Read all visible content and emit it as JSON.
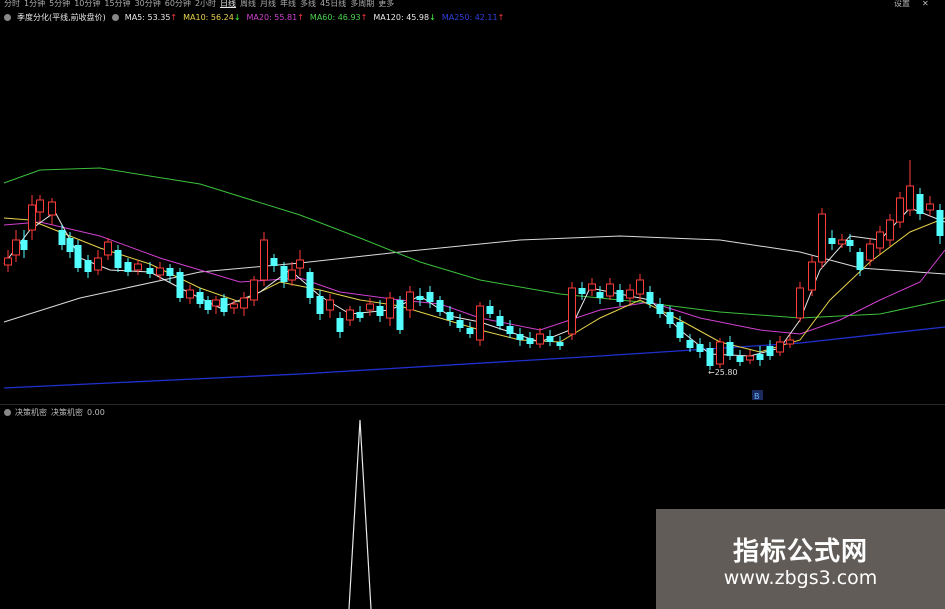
{
  "toolbar": {
    "periods": [
      {
        "label": "分时",
        "state": "normal"
      },
      {
        "label": "1分钟",
        "state": "normal"
      },
      {
        "label": "5分钟",
        "state": "normal"
      },
      {
        "label": "10分钟",
        "state": "normal"
      },
      {
        "label": "15分钟",
        "state": "normal"
      },
      {
        "label": "30分钟",
        "state": "normal"
      },
      {
        "label": "60分钟",
        "state": "normal"
      },
      {
        "label": "2小时",
        "state": "normal"
      },
      {
        "label": "日线",
        "state": "selected"
      },
      {
        "label": "周线",
        "state": "normal"
      },
      {
        "label": "月线",
        "state": "normal"
      },
      {
        "label": "年线",
        "state": "normal"
      },
      {
        "label": "多线",
        "state": "normal"
      },
      {
        "label": "45日线",
        "state": "normal"
      },
      {
        "label": "多周期",
        "state": "normal"
      },
      {
        "label": "更多",
        "state": "normal"
      }
    ],
    "settings_label": "设置",
    "close_label": "✕"
  },
  "ma_legend": {
    "title": "季度分化(平线,前收盘价)",
    "items": [
      {
        "label": "MA5: 53.35",
        "color": "#e8e8e8",
        "arrow": "↑"
      },
      {
        "label": "MA10: 56.24",
        "color": "#e8d24a",
        "arrow": "↓"
      },
      {
        "label": "MA20: 55.81",
        "color": "#d040d0",
        "arrow": "↑"
      },
      {
        "label": "MA60: 46.93",
        "color": "#4ad24a",
        "arrow": "↑"
      },
      {
        "label": "MA120: 45.98",
        "color": "#e8e8e8",
        "arrow": "↓"
      },
      {
        "label": "MA250: 42.11",
        "color": "#3040e0",
        "arrow": "↑"
      }
    ]
  },
  "main_chart": {
    "low_marker_label": "←25.80",
    "date_badge": "B"
  },
  "indicator": {
    "name": "决策机密",
    "param": "决策机密",
    "value": "0.00"
  },
  "watermark": {
    "title": "指标公式网",
    "url": "www.zbgs3.com"
  },
  "colors": {
    "up": "#ff3c3c",
    "down": "#54ffff",
    "ma5": "#e8e8e8",
    "ma10": "#e8d24a",
    "ma20": "#d040d0",
    "ma60": "#3cc03c",
    "ma120": "#dcdcdc",
    "ma250": "#2030d0"
  }
}
